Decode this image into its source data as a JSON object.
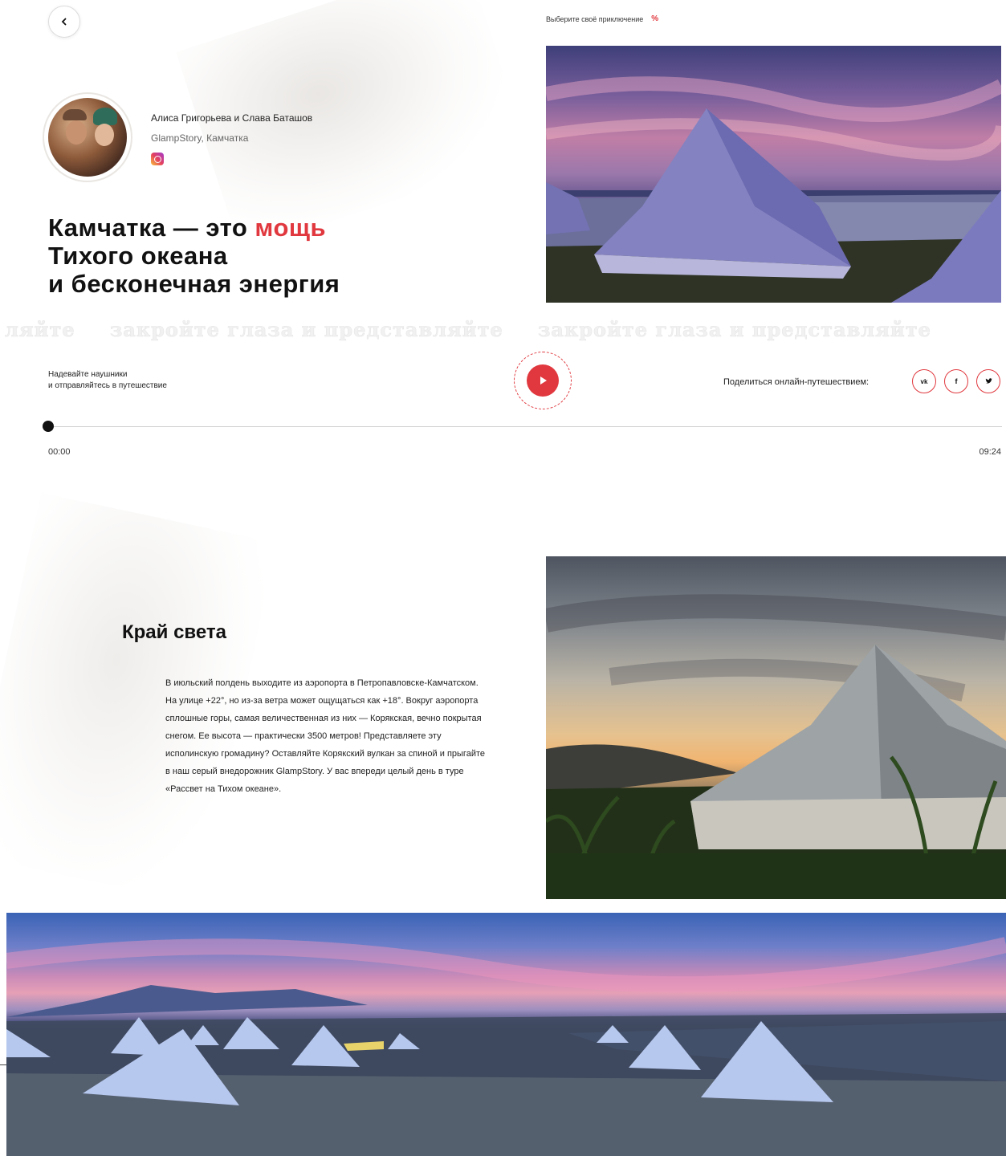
{
  "nav": {
    "back_icon": "chevron-left-icon",
    "choose_label": "Выберите своё приключение",
    "choose_icon": "percent-icon"
  },
  "author": {
    "names": "Алиса Григорьева и Слава Баташов",
    "place": "GlampStory, Камчатка",
    "social_icon": "instagram-icon"
  },
  "headline": {
    "line1_prefix": "Камчатка — это ",
    "line1_accent": "мощь",
    "line2": "Тихого океана",
    "line3": "и бесконечная энергия"
  },
  "ticker": {
    "phrases": [
      "ляйте",
      "закройте глаза и представляйте",
      "закройте глаза и представляйте"
    ]
  },
  "player": {
    "hint_line1": "Надевайте наушники",
    "hint_line2": "и отправляйтесь в путешествие",
    "play_icon": "play-icon",
    "share_label": "Поделиться онлайн-путешествием:",
    "share_buttons": [
      "vk",
      "f",
      "twitter"
    ],
    "progress": 0,
    "time_current": "00:00",
    "time_total": "09:24"
  },
  "section": {
    "title": "Край света",
    "text": "В июльский полдень выходите из аэропорта в Петропавловске-Камчатском. На улице +22°, но из-за ветра может ощущаться как +18°. Вокруг аэропорта сплошные горы, самая величественная из них — Корякская, вечно покрытая снегом. Ее высота — практически 3500 метров! Представляете эту исполинскую громадину? Оставляйте Корякский вулкан за спиной и прыгайте в наш серый внедорожник GlampStory. У вас впереди целый день в туре «Рассвет на Тихом океане»."
  },
  "colors": {
    "accent": "#e0383e",
    "text": "#111111"
  }
}
